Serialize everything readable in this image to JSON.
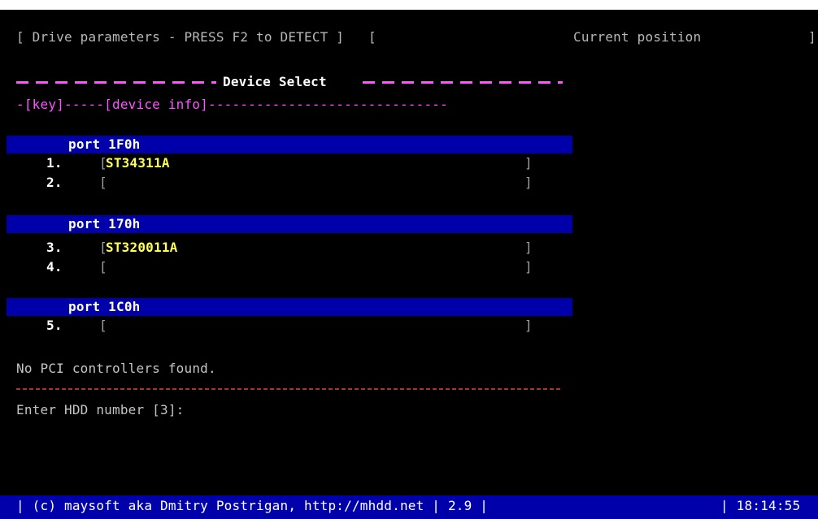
{
  "header": {
    "drive_params": "[ Drive parameters - PRESS F2 to DETECT ]",
    "current_open": "[",
    "current_label": "Current position",
    "current_close": "]"
  },
  "device_select": {
    "title": "Device Select",
    "columns": "-[key]-----[device info]------------------------------"
  },
  "ports": [
    {
      "label": "port 1F0h",
      "slots": [
        {
          "number": "1.",
          "device": "ST34311A"
        },
        {
          "number": "2.",
          "device": ""
        }
      ]
    },
    {
      "label": "port 170h",
      "slots": [
        {
          "number": "3.",
          "device": "ST320011A"
        },
        {
          "number": "4.",
          "device": ""
        }
      ]
    },
    {
      "label": "port 1C0h",
      "slots": [
        {
          "number": "5.",
          "device": ""
        }
      ]
    }
  ],
  "bracket_open": "[",
  "bracket_close": "]",
  "pci_message": "No PCI controllers found.",
  "prompt": "Enter HDD number [3]:",
  "status_bar": {
    "copyright": "| (c) maysoft aka Dmitry Postrigan, http://mhdd.net | 2.9 |",
    "clock": "| 18:14:55"
  },
  "colors": {
    "background": "#000000",
    "blue_bar": "#0000aa",
    "magenta": "#ff55ff",
    "yellow": "#ffff55",
    "red_divider": "#b03030"
  }
}
